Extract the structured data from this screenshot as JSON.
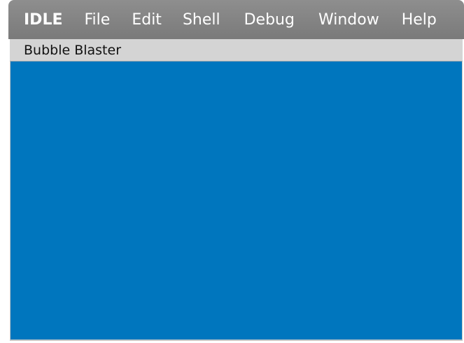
{
  "menubar": {
    "items": [
      {
        "label": "IDLE"
      },
      {
        "label": "File"
      },
      {
        "label": "Edit"
      },
      {
        "label": "Shell"
      },
      {
        "label": "Debug"
      },
      {
        "label": "Window"
      },
      {
        "label": "Help"
      }
    ]
  },
  "window": {
    "title": "Bubble Blaster"
  },
  "colors": {
    "canvas_background": "#0076be",
    "menubar": "#858585",
    "titlebar": "#d4d4d4"
  }
}
